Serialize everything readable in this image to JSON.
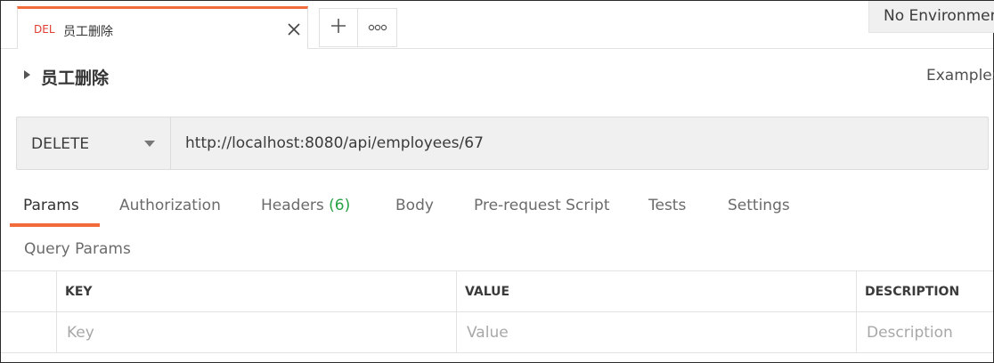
{
  "tabs": {
    "active": {
      "method": "DEL",
      "title": "员工删除"
    },
    "add_icon": "plus-icon",
    "more_icon": "more-horizontal-icon"
  },
  "environment": {
    "selected": "No Environment"
  },
  "request": {
    "name": "员工删除",
    "examples_label": "Examples",
    "method": "DELETE",
    "url": "http://localhost:8080/api/employees/67"
  },
  "subtabs": {
    "params": "Params",
    "authorization": "Authorization",
    "headers": "Headers",
    "headers_count": "(6)",
    "body": "Body",
    "prerequest": "Pre-request Script",
    "tests": "Tests",
    "settings": "Settings"
  },
  "query_params": {
    "title": "Query Params",
    "columns": {
      "key": "KEY",
      "value": "VALUE",
      "description": "DESCRIPTION"
    },
    "placeholders": {
      "key": "Key",
      "value": "Value",
      "description": "Description"
    }
  },
  "colors": {
    "accent": "#f26b3a",
    "delete_method": "#e03c31",
    "count_green": "#27a244"
  }
}
